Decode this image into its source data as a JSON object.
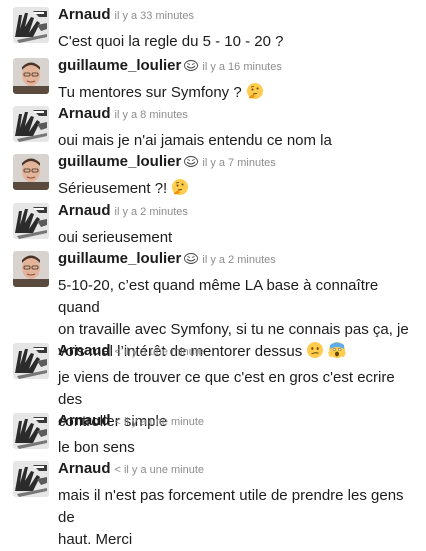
{
  "messages": [
    {
      "author": "Arnaud",
      "avatar": "arnaud",
      "time": "il y a 33 minutes",
      "lines": [
        "C'est quoi la regle du 5 - 10 - 20 ?"
      ]
    },
    {
      "author": "guillaume_loulier",
      "avatar": "guillaume",
      "badge": "troll-face",
      "time": "il y a 16 minutes",
      "lines": [
        "Tu mentores sur Symfony ?"
      ],
      "emoji": [
        "thinking-face"
      ]
    },
    {
      "author": "Arnaud",
      "avatar": "arnaud",
      "time": "il y a 8 minutes",
      "lines": [
        "oui mais je n'ai jamais entendu ce nom la"
      ]
    },
    {
      "author": "guillaume_loulier",
      "avatar": "guillaume",
      "badge": "troll-face",
      "time": "il y a 7 minutes",
      "lines": [
        "Sérieusement ?!"
      ],
      "emoji": [
        "thinking-face"
      ]
    },
    {
      "author": "Arnaud",
      "avatar": "arnaud",
      "time": "il y a 2 minutes",
      "lines": [
        "oui serieusement"
      ]
    },
    {
      "author": "guillaume_loulier",
      "avatar": "guillaume",
      "badge": "troll-face",
      "time": "il y a 2 minutes",
      "lines": [
        "5-10-20, c’est quand même LA base à connaître quand",
        "on travaille avec Symfony, si tu ne connais pas ça, je",
        "vois mal l’intérêt de mentorer dessus"
      ],
      "emoji": [
        "confused-face",
        "screaming-face"
      ]
    },
    {
      "author": "Arnaud",
      "avatar": "arnaud",
      "caret": "<",
      "time": "il y a une minute",
      "lines": [
        "je viens de trouver ce que c'est en gros c'est ecrire des",
        "controller simple"
      ]
    },
    {
      "author": "Arnaud",
      "avatar": "arnaud",
      "caret": "<",
      "time": "il y a une minute",
      "lines": [
        "le bon sens"
      ]
    },
    {
      "author": "Arnaud",
      "avatar": "arnaud",
      "caret": "<",
      "time": "il y a une minute",
      "lines": [
        "mais il n'est pas forcement utile de prendre les gens de",
        "haut. Merci"
      ]
    }
  ]
}
